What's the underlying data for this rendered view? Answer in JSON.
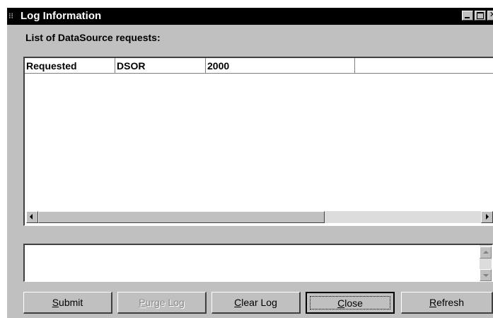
{
  "window": {
    "title": "Log Information",
    "icon": "app-icon"
  },
  "list_label": "List of DataSource requests:",
  "list": {
    "headers": [
      "Requested",
      "DSOR",
      "2000",
      ""
    ]
  },
  "message_box": {
    "text": ""
  },
  "buttons": {
    "submit": {
      "accel": "S",
      "rest": "ubmit",
      "enabled": true
    },
    "purge": {
      "accel": "P",
      "rest": "urge Log",
      "enabled": false
    },
    "clear": {
      "accel": "C",
      "rest": "lear Log",
      "enabled": true
    },
    "close": {
      "accel": "C",
      "rest": "lose",
      "enabled": true,
      "default": true
    },
    "refresh": {
      "accel": "R",
      "rest": "efresh",
      "enabled": true
    }
  }
}
